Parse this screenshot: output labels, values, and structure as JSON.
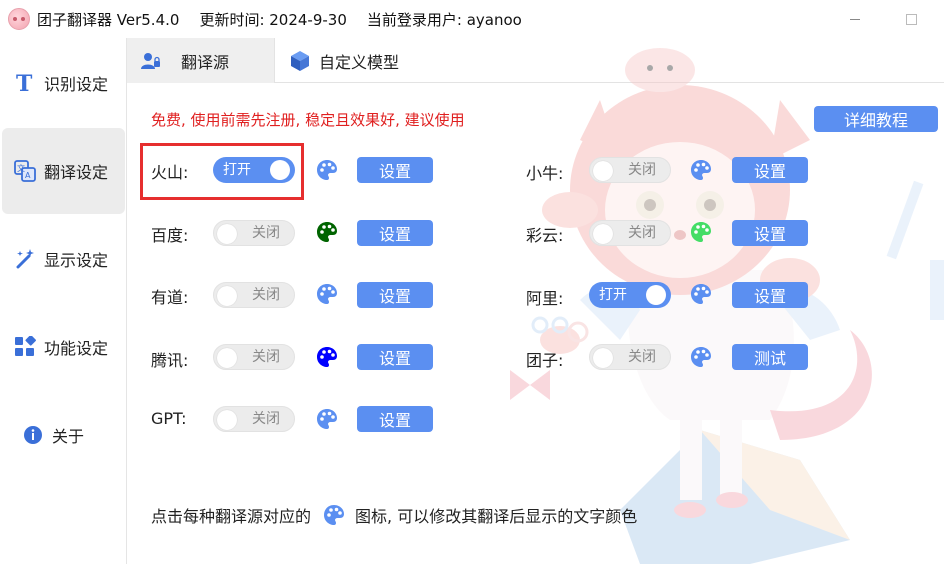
{
  "window": {
    "app_name": "团子翻译器 Ver5.4.0",
    "update_time": "更新时间: 2024-9-30",
    "current_user": "当前登录用户: ayanoo"
  },
  "sidebar": {
    "items": [
      {
        "label": "识别设定",
        "icon": "text-t-icon"
      },
      {
        "label": "翻译设定",
        "icon": "translate-icon",
        "active": true
      },
      {
        "label": "显示设定",
        "icon": "magic-wand-icon"
      },
      {
        "label": "功能设定",
        "icon": "apps-grid-icon"
      },
      {
        "label": "关于",
        "icon": "info-icon"
      }
    ]
  },
  "tabs": [
    {
      "label": "翻译源",
      "icon": "user-lock-icon",
      "active": true
    },
    {
      "label": "自定义模型",
      "icon": "cube-icon",
      "active": false
    }
  ],
  "content": {
    "notice": "免费, 使用前需先注册, 稳定且效果好, 建议使用",
    "tutorial_label": "详细教程",
    "footer_prefix": "点击每种翻译源对应的",
    "footer_suffix": "图标, 可以修改其翻译后显示的文字颜色",
    "on_label": "打开",
    "off_label": "关闭",
    "left_sources": [
      {
        "name": "火山:",
        "enabled": true,
        "button": "设置",
        "color": "#5b8ff1"
      },
      {
        "name": "百度:",
        "enabled": false,
        "button": "设置",
        "color": "#006400"
      },
      {
        "name": "有道:",
        "enabled": false,
        "button": "设置",
        "color": "#5b8ff1"
      },
      {
        "name": "腾讯:",
        "enabled": false,
        "button": "设置",
        "color": "#0000ff"
      },
      {
        "name": "GPT:",
        "enabled": false,
        "button": "设置",
        "color": "#5b8ff1"
      }
    ],
    "right_sources": [
      {
        "name": "小牛:",
        "enabled": false,
        "button": "设置",
        "color": "#5b8ff1"
      },
      {
        "name": "彩云:",
        "enabled": false,
        "button": "设置",
        "color": "#44dd66"
      },
      {
        "name": "阿里:",
        "enabled": true,
        "button": "设置",
        "color": "#5b8ff1"
      },
      {
        "name": "团子:",
        "enabled": false,
        "button": "测试",
        "color": "#5b8ff1"
      }
    ]
  },
  "colors": {
    "accent": "#5b8ff1",
    "highlight_border": "#e62e2e",
    "notice_text": "#e02020"
  }
}
